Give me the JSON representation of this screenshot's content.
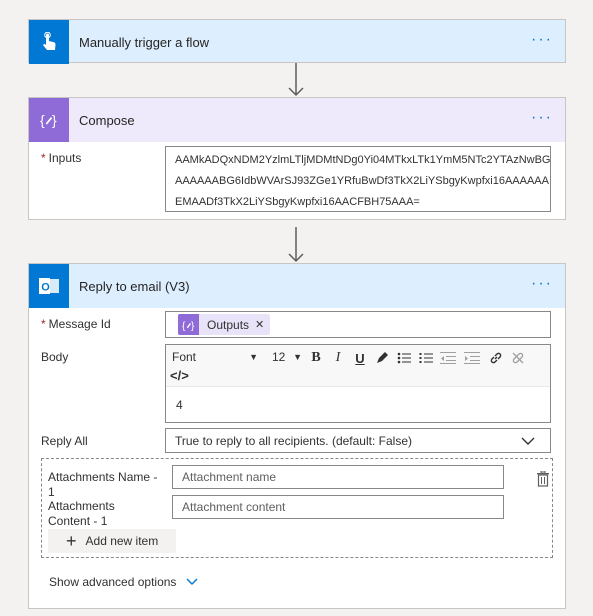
{
  "trigger": {
    "title": "Manually trigger a flow",
    "more": "···",
    "color": "#0078d4"
  },
  "compose": {
    "title": "Compose",
    "more": "···",
    "color": "#8f6bd8",
    "inputs_label": "Inputs",
    "inputs_lines": [
      "AAMkADQxNDM2YzlmLTljMDMtNDg0Yi04MTkxLTk1YmM5NTc2YTAzNwBG",
      "AAAAAABG6IdbWVArSJ93ZGe1YRfuBwDf3TkX2LiYSbgyKwpfxi16AAAAAA",
      "EMAADf3TkX2LiYSbgyKwpfxi16AACFBH75AAA="
    ]
  },
  "reply": {
    "title": "Reply to email (V3)",
    "more": "···",
    "color": "#0078d4",
    "message_id_label": "Message Id",
    "message_id_token": "Outputs",
    "body_label": "Body",
    "toolbar": {
      "font": "Font",
      "size": "12",
      "code": "</>"
    },
    "body_value": "4",
    "reply_all_label": "Reply All",
    "reply_all_value": "True to reply to all recipients. (default: False)",
    "attachments_name_label": "Attachments Name - 1",
    "attachments_name_placeholder": "Attachment name",
    "attachments_content_label": "Attachments Content - 1",
    "attachments_content_placeholder": "Attachment content",
    "add_new_item": "Add new item",
    "show_advanced": "Show advanced options"
  }
}
